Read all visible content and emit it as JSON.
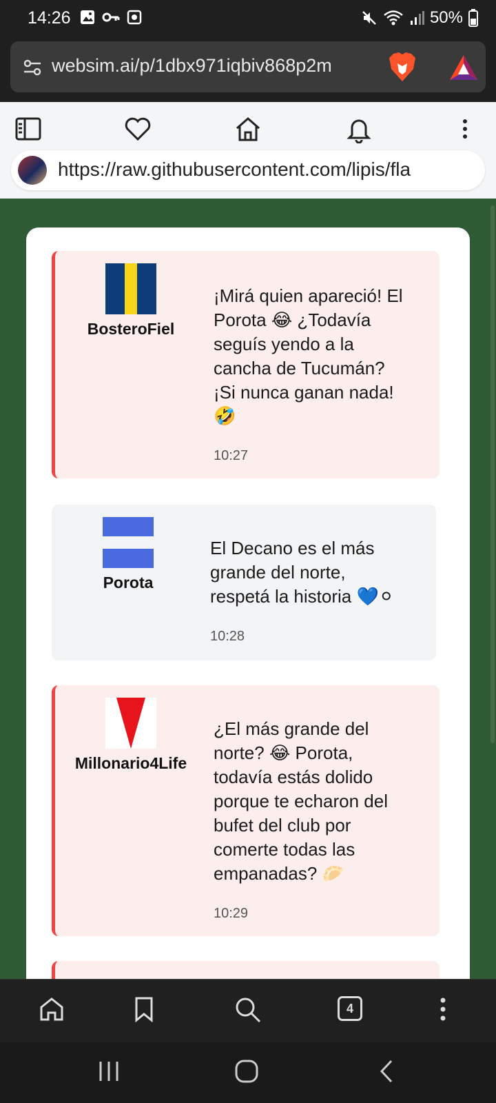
{
  "status_bar": {
    "time": "14:26",
    "battery": "50%"
  },
  "browser": {
    "url": "websim.ai/p/1dbx971iqbiv868p2m",
    "secondary_url": "https://raw.githubusercontent.com/lipis/fla"
  },
  "messages": [
    {
      "username": "BosteroFiel",
      "lines": [
        "¡Mirá quien apareció! El",
        "Porota 😂 ¿Todavía",
        "seguís yendo a la",
        "cancha de Tucumán?",
        "¡Si nunca ganan nada!",
        "🤣"
      ],
      "time": "10:27",
      "style": "rival",
      "flag": "boca"
    },
    {
      "username": "Porota",
      "lines": [
        "El Decano es el más",
        "grande del norte,",
        "respetá la historia 💙⚪"
      ],
      "time": "10:28",
      "style": "self",
      "flag": "atletico"
    },
    {
      "username": "Millonario4Life",
      "lines": [
        "¿El más grande del",
        "norte? 😂 Porota,",
        "todavía estás dolido",
        "porque te echaron del",
        "bufet del club por",
        "comerte todas las",
        "empanadas? 🥟"
      ],
      "time": "10:29",
      "style": "rival",
      "flag": "river"
    }
  ],
  "bottom_nav": {
    "tab_count": "4"
  },
  "colors": {
    "page_bg": "#2f5b34",
    "rival_bg": "#fdeeee",
    "rival_border": "#ef4444",
    "self_bg": "#f3f4f6"
  }
}
